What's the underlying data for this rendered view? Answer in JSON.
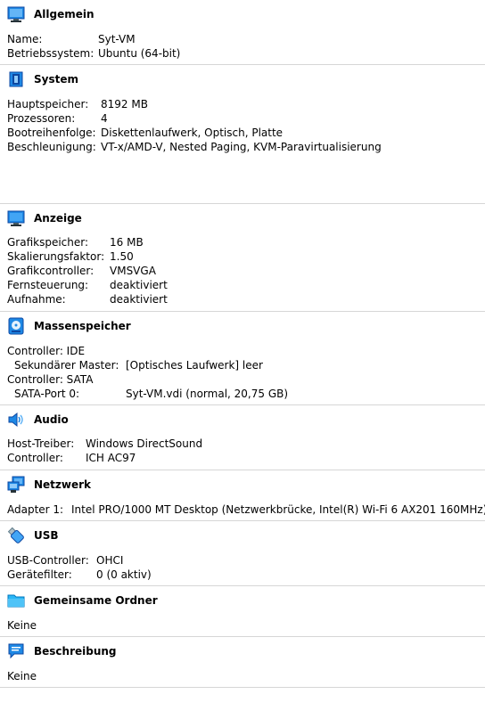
{
  "sections": {
    "general": {
      "title": "Allgemein",
      "icon": "monitor-icon",
      "rows": [
        {
          "label": "Name:",
          "value": "Syt-VM"
        },
        {
          "label": "Betriebssystem:",
          "value": "Ubuntu (64-bit)"
        }
      ]
    },
    "system": {
      "title": "System",
      "icon": "chip-icon",
      "rows": [
        {
          "label": "Hauptspeicher:",
          "value": "8192 MB"
        },
        {
          "label": "Prozessoren:",
          "value": "4"
        },
        {
          "label": "Bootreihenfolge:",
          "value": "Diskettenlaufwerk, Optisch, Platte"
        },
        {
          "label": "Beschleunigung:",
          "value": "VT-x/AMD-V, Nested Paging, KVM-Paravirtualisierung"
        }
      ]
    },
    "display": {
      "title": "Anzeige",
      "icon": "display-icon",
      "rows": [
        {
          "label": "Grafikspeicher:",
          "value": "16 MB"
        },
        {
          "label": "Skalierungsfaktor:",
          "value": "1.50"
        },
        {
          "label": "Grafikcontroller:",
          "value": "VMSVGA"
        },
        {
          "label": "Fernsteuerung:",
          "value": "deaktiviert"
        },
        {
          "label": "Aufnahme:",
          "value": "deaktiviert"
        }
      ]
    },
    "storage": {
      "title": "Massenspeicher",
      "icon": "storage-disk-icon",
      "rows": [
        {
          "label": "Controller: IDE",
          "value": ""
        },
        {
          "label": "Sekundärer Master:",
          "value": "[Optisches Laufwerk] leer"
        },
        {
          "label": "Controller: SATA",
          "value": ""
        },
        {
          "label": "SATA-Port 0:",
          "value": "Syt-VM.vdi (normal, 20,75 GB)"
        }
      ]
    },
    "audio": {
      "title": "Audio",
      "icon": "speaker-icon",
      "rows": [
        {
          "label": "Host-Treiber:",
          "value": "Windows DirectSound"
        },
        {
          "label": "Controller:",
          "value": "ICH AC97"
        }
      ]
    },
    "network": {
      "title": "Netzwerk",
      "icon": "network-icon",
      "rows": [
        {
          "label": "Adapter 1:",
          "value": "Intel PRO/1000 MT Desktop (Netzwerkbrücke, Intel(R) Wi-Fi 6 AX201 160MHz)"
        }
      ]
    },
    "usb": {
      "title": "USB",
      "icon": "usb-icon",
      "rows": [
        {
          "label": "USB-Controller:",
          "value": "OHCI"
        },
        {
          "label": "Gerätefilter:",
          "value": "0 (0 aktiv)"
        }
      ]
    },
    "shared": {
      "title": "Gemeinsame Ordner",
      "icon": "folder-icon",
      "rows": [
        {
          "label": "Keine",
          "value": ""
        }
      ]
    },
    "description": {
      "title": "Beschreibung",
      "icon": "speech-bubble-icon",
      "rows": [
        {
          "label": "Keine",
          "value": ""
        }
      ]
    }
  }
}
